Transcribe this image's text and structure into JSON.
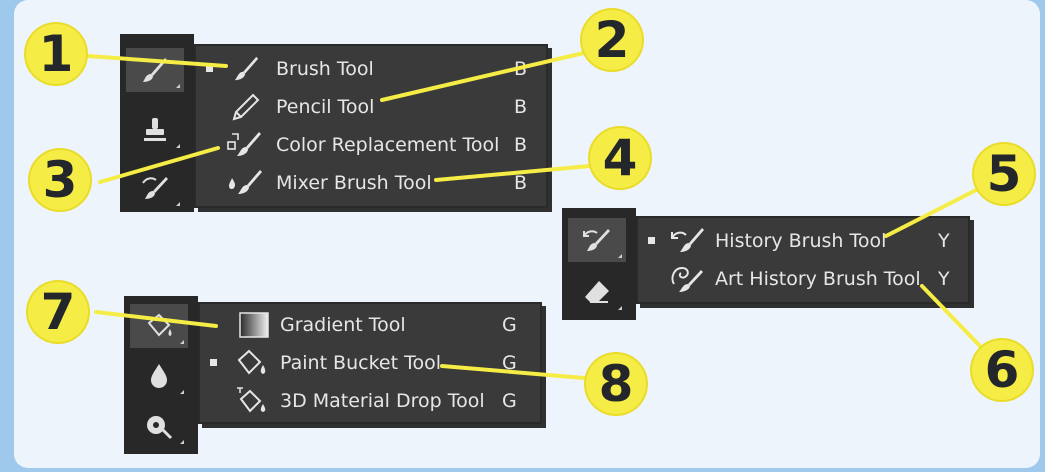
{
  "groups": {
    "brush": {
      "tools": [
        {
          "label": "Brush Tool",
          "key": "B",
          "icon": "brush-icon",
          "active": true
        },
        {
          "label": "Pencil Tool",
          "key": "B",
          "icon": "pencil-icon",
          "active": false
        },
        {
          "label": "Color Replacement Tool",
          "key": "B",
          "icon": "color-replacement-icon",
          "active": false
        },
        {
          "label": "Mixer Brush Tool",
          "key": "B",
          "icon": "mixer-brush-icon",
          "active": false
        }
      ]
    },
    "history": {
      "tools": [
        {
          "label": "History Brush Tool",
          "key": "Y",
          "icon": "history-brush-icon",
          "active": true
        },
        {
          "label": "Art History Brush Tool",
          "key": "Y",
          "icon": "art-history-brush-icon",
          "active": false
        }
      ]
    },
    "gradient": {
      "tools": [
        {
          "label": "Gradient Tool",
          "key": "G",
          "icon": "gradient-icon",
          "active": false
        },
        {
          "label": "Paint Bucket Tool",
          "key": "G",
          "icon": "paint-bucket-icon",
          "active": true
        },
        {
          "label": "3D Material Drop Tool",
          "key": "G",
          "icon": "3d-material-drop-icon",
          "active": false
        }
      ]
    }
  },
  "callouts": [
    "1",
    "2",
    "3",
    "4",
    "5",
    "6",
    "7",
    "8"
  ],
  "colors": {
    "background": "#9ec8ec",
    "card": "#eef4fb",
    "panel": "#3a3a3a",
    "toolbar": "#282828",
    "callout": "#f5ec45",
    "leader_line": "#f5ec45"
  }
}
